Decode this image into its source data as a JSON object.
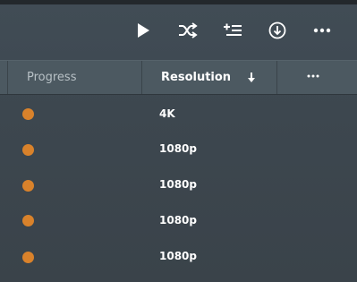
{
  "toolbar": {
    "buttons": [
      {
        "name": "play-button",
        "icon": "play-icon"
      },
      {
        "name": "shuffle-button",
        "icon": "shuffle-icon"
      },
      {
        "name": "add-to-queue-button",
        "icon": "add-to-queue-icon"
      },
      {
        "name": "download-button",
        "icon": "download-icon"
      },
      {
        "name": "more-options-button",
        "icon": "more-icon"
      }
    ]
  },
  "columns": {
    "progress_label": "Progress",
    "resolution_label": "Resolution",
    "sort_direction": "descending",
    "more_label": "•••"
  },
  "rows": [
    {
      "progress_color": "#d9822b",
      "resolution": "4K"
    },
    {
      "progress_color": "#d9822b",
      "resolution": "1080p"
    },
    {
      "progress_color": "#d9822b",
      "resolution": "1080p"
    },
    {
      "progress_color": "#d9822b",
      "resolution": "1080p"
    },
    {
      "progress_color": "#d9822b",
      "resolution": "1080p"
    }
  ],
  "colors": {
    "accent_dot": "#d9822b",
    "header_bg": "#4c5961",
    "body_bg": "#3d474f"
  }
}
